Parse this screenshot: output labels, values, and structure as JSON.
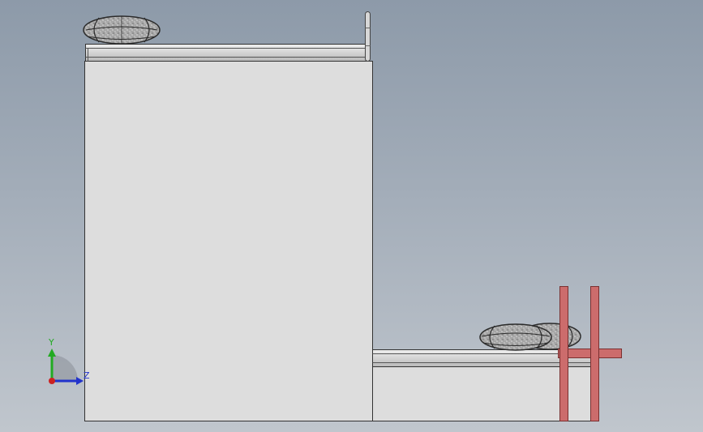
{
  "viewport": {
    "background_top": "#8d9aa9",
    "background_bottom": "#c0c6cd"
  },
  "model": {
    "body_color": "#dddddd",
    "edge_color": "#333333",
    "rail_color": "#cfcfcf",
    "bracket_color": "#cc6c6c",
    "cushion_color": "#9a9a9a"
  },
  "triad": {
    "y_label": "Y",
    "z_label": "Z",
    "y_color": "#22aa22",
    "z_color": "#2233cc",
    "origin_color": "#cc2222"
  }
}
